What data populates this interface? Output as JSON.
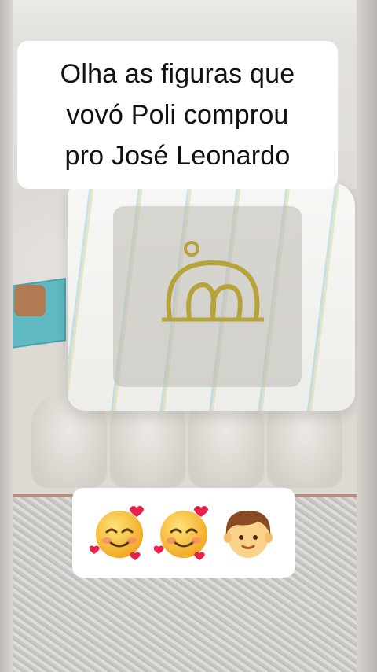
{
  "caption": {
    "text": "Olha as figuras que\nvovó Poli comprou\npro José Leonardo"
  },
  "emojis": [
    {
      "name": "smiling-face-with-hearts-icon"
    },
    {
      "name": "smiling-face-with-hearts-icon"
    },
    {
      "name": "boy-face-icon"
    }
  ],
  "colors": {
    "bag_stripe_blue": "#78bed2",
    "bag_stripe_yellow": "#d2c878",
    "teal_box": "#5fb9c2",
    "logo_gold": "#b8a23a"
  }
}
